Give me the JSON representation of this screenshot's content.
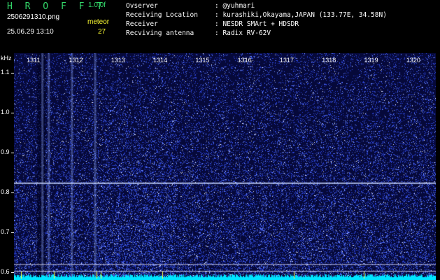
{
  "header": {
    "brand": "H R O F F T",
    "version": "1.0.0f",
    "filename": "2506291310.png",
    "datetime": "25.06.29 13:10",
    "meteor_label": "meteor",
    "meteor_count": "27",
    "info": [
      {
        "label": "Ovserver",
        "value": ": @yuhmari"
      },
      {
        "label": "Receiving Location",
        "value": ": kurashiki,Okayama,JAPAN (133.77E, 34.58N)"
      },
      {
        "label": "Receiver",
        "value": ": NESDR SMArt + HDSDR"
      },
      {
        "label": "Recviving antenna",
        "value": ": Radix RV-62V"
      }
    ]
  },
  "chart_data": {
    "type": "heatmap",
    "title": "",
    "x_unit": "",
    "x_ticks": [
      "1311",
      "1312",
      "1313",
      "1314",
      "1315",
      "1316",
      "1317",
      "1318",
      "1319",
      "1320"
    ],
    "x_range_seconds": [
      1310.5,
      1320.5
    ],
    "y_unit": "kHz",
    "y_ticks": [
      "1.1",
      "1.0",
      "0.9",
      "0.8",
      "0.7",
      "0.6"
    ],
    "y_range_khz": [
      0.58,
      1.15
    ],
    "colors": {
      "background": "#06093a",
      "noise": "#3a5cff",
      "signal": "#ffffff",
      "spectrum": "#00e5ff"
    },
    "features": {
      "horizontal_carrier_khz": 0.825,
      "vertical_bright_columns_seconds": [
        1311.15,
        1311.3,
        1311.85,
        1312.4
      ],
      "reference_lines_khz": [
        0.62,
        0.603
      ]
    }
  }
}
